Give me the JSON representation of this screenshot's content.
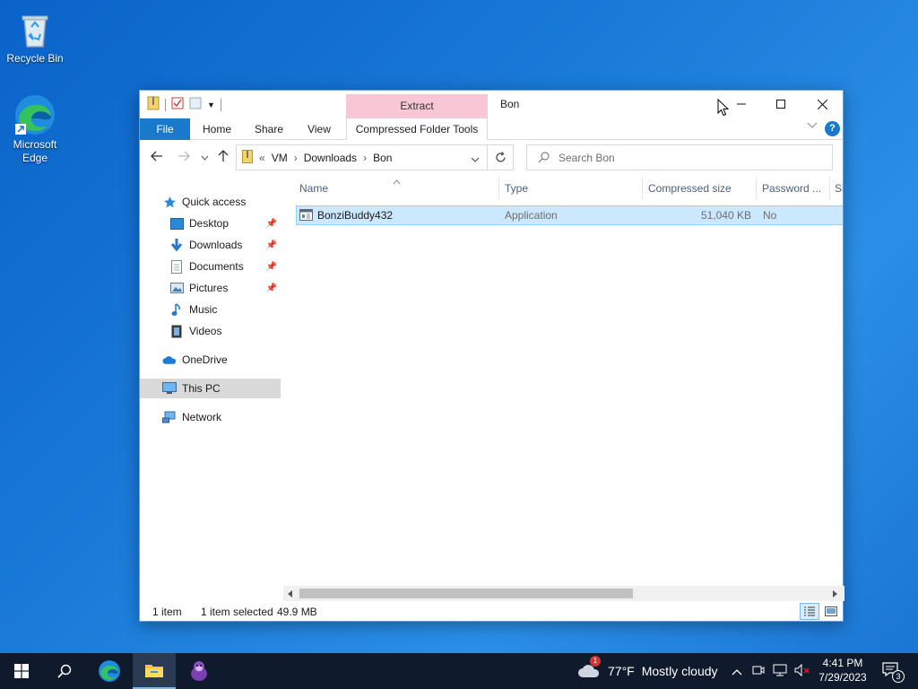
{
  "desktop": {
    "recycle_bin": "Recycle Bin",
    "edge": "Microsoft Edge"
  },
  "window": {
    "context_tab": "Extract",
    "title": "Bon",
    "ribbon_tabs": [
      "File",
      "Home",
      "Share",
      "View"
    ],
    "context_ribbon_tab": "Compressed Folder Tools"
  },
  "address": {
    "overflow": "«",
    "crumbs": [
      "VM",
      "Downloads",
      "Bon"
    ]
  },
  "search": {
    "placeholder": "Search Bon"
  },
  "nav": {
    "quick_access": "Quick access",
    "desktop": "Desktop",
    "downloads": "Downloads",
    "documents": "Documents",
    "pictures": "Pictures",
    "music": "Music",
    "videos": "Videos",
    "onedrive": "OneDrive",
    "this_pc": "This PC",
    "network": "Network"
  },
  "columns": {
    "name": "Name",
    "type": "Type",
    "compressed_size": "Compressed size",
    "password": "Password ...",
    "size": "Si"
  },
  "files": [
    {
      "name": "BonziBuddy432",
      "type": "Application",
      "compressed_size": "51,040 KB",
      "password": "No"
    }
  ],
  "status": {
    "count": "1 item",
    "selected": "1 item selected",
    "size": "49.9 MB"
  },
  "taskbar": {
    "weather_temp": "77°F",
    "weather_text": "Mostly cloudy",
    "weather_badge": "1",
    "time": "4:41 PM",
    "date": "7/29/2023",
    "notification_count": "3"
  },
  "colors": {
    "accent": "#1979ca",
    "context_tab": "#f9c6d6",
    "selection": "#cce8ff",
    "taskbar": "#0f1a2c"
  }
}
